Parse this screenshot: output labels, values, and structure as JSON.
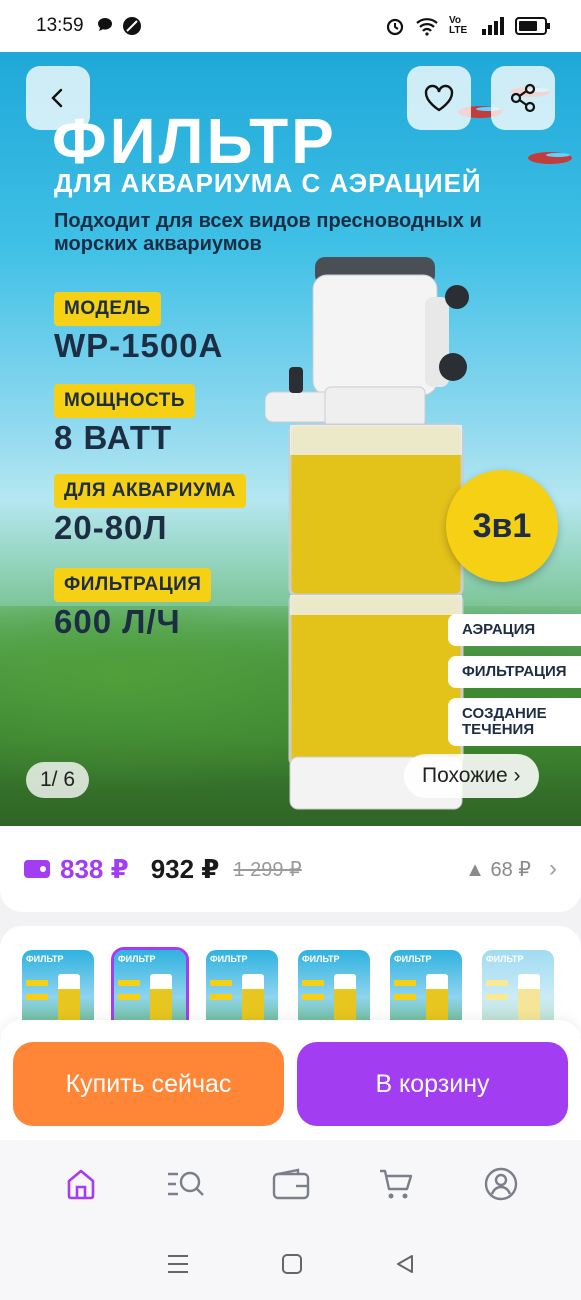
{
  "status_bar": {
    "time": "13:59",
    "network_label": "Vo LTE",
    "icons": [
      "chat-bubble-icon",
      "do-not-disturb-icon",
      "alarm-icon",
      "wifi-icon",
      "signal-icon",
      "battery-icon"
    ]
  },
  "hero": {
    "title": "ФИЛЬТР",
    "subtitle": "ДЛЯ АКВАРИУМА С АЭРАЦИЕЙ",
    "description": "Подходит для всех видов пресноводных и морских аквариумов",
    "specs": [
      {
        "label": "МОДЕЛЬ",
        "value": "WP-1500A"
      },
      {
        "label": "МОЩНОСТЬ",
        "value": "8 ВАТТ"
      },
      {
        "label": "ДЛЯ АКВАРИУМА",
        "value": "20-80Л"
      },
      {
        "label": "ФИЛЬТРАЦИЯ",
        "value": "600 Л/Ч"
      }
    ],
    "badge": "3в1",
    "features": [
      "АЭРАЦИЯ",
      "ФИЛЬТРАЦИЯ",
      "СОЗДАНИЕ ТЕЧЕНИЯ"
    ],
    "counter": "1/ 6",
    "similar_label": "Похожие ›"
  },
  "price": {
    "wallet_price": "838 ₽",
    "price": "932 ₽",
    "old_price": "1 299 ₽",
    "trend": "▲ 68 ₽",
    "accent_color": "#a23df2"
  },
  "thumbnails": [
    {
      "title": "ФИЛЬТР",
      "active": false,
      "faded": false
    },
    {
      "title": "ФИЛЬТР",
      "active": true,
      "faded": false
    },
    {
      "title": "ФИЛЬТР",
      "active": false,
      "faded": false
    },
    {
      "title": "ФИЛЬТР",
      "active": false,
      "faded": false
    },
    {
      "title": "ФИЛЬТР",
      "active": false,
      "faded": false
    },
    {
      "title": "ФИЛЬТР",
      "active": false,
      "faded": true
    }
  ],
  "actions": {
    "buy_now": "Купить сейчас",
    "add_to_cart": "В корзину",
    "buy_color": "#ff8636",
    "cart_color": "#a23df2"
  },
  "tabs": [
    {
      "name": "home-icon",
      "active": true
    },
    {
      "name": "catalog-search-icon",
      "active": false
    },
    {
      "name": "wallet-icon",
      "active": false
    },
    {
      "name": "cart-icon",
      "active": false
    },
    {
      "name": "profile-icon",
      "active": false
    }
  ]
}
